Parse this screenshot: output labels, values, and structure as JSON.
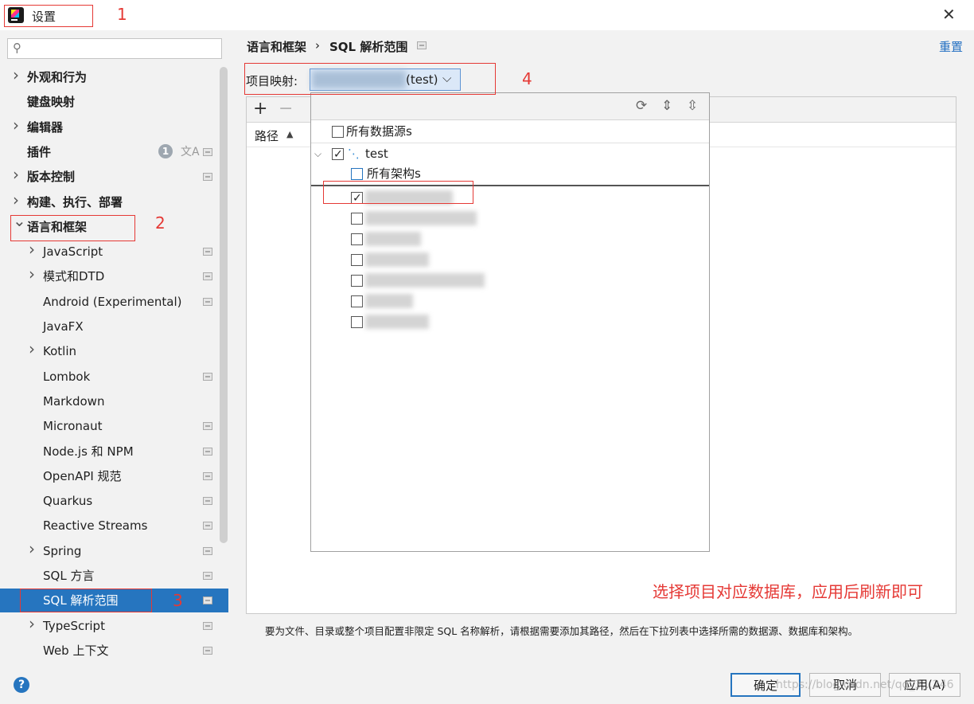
{
  "window": {
    "title": "设置",
    "close_glyph": "✕"
  },
  "sidebar": {
    "search_placeholder": "",
    "badge_count": "1",
    "items": [
      {
        "label": "外观和行为",
        "bold": true,
        "arrow": "right"
      },
      {
        "label": "键盘映射",
        "bold": true,
        "arrow": ""
      },
      {
        "label": "编辑器",
        "bold": true,
        "arrow": "right"
      },
      {
        "label": "插件",
        "bold": true,
        "arrow": ""
      },
      {
        "label": "版本控制",
        "bold": true,
        "arrow": "right"
      },
      {
        "label": "构建、执行、部署",
        "bold": true,
        "arrow": "right"
      },
      {
        "label": "语言和框架",
        "bold": true,
        "arrow": "down"
      },
      {
        "label": "JavaScript",
        "arrow": "right"
      },
      {
        "label": "模式和DTD",
        "arrow": "right"
      },
      {
        "label": "Android (Experimental)",
        "arrow": ""
      },
      {
        "label": "JavaFX",
        "arrow": ""
      },
      {
        "label": "Kotlin",
        "arrow": "right"
      },
      {
        "label": "Lombok",
        "arrow": ""
      },
      {
        "label": "Markdown",
        "arrow": ""
      },
      {
        "label": "Micronaut",
        "arrow": ""
      },
      {
        "label": "Node.js 和 NPM",
        "arrow": ""
      },
      {
        "label": "OpenAPI 规范",
        "arrow": ""
      },
      {
        "label": "Quarkus",
        "arrow": ""
      },
      {
        "label": "Reactive Streams",
        "arrow": ""
      },
      {
        "label": "Spring",
        "arrow": "right"
      },
      {
        "label": "SQL 方言",
        "arrow": ""
      },
      {
        "label": "SQL 解析范围",
        "arrow": "",
        "selected": true
      },
      {
        "label": "TypeScript",
        "arrow": "right"
      },
      {
        "label": "Web 上下文",
        "arrow": ""
      }
    ]
  },
  "breadcrumb": {
    "parent": "语言和框架",
    "separator": "›",
    "current": "SQL 解析范围"
  },
  "reset_label": "重置",
  "mapping": {
    "label": "项目映射:",
    "value": "(test)"
  },
  "table": {
    "column_path": "路径",
    "add_glyph": "+",
    "remove_glyph": "−"
  },
  "dropdown": {
    "all_datasources": "所有数据源s",
    "datasource_name": "test",
    "all_schemas": "所有架构s"
  },
  "annotations": {
    "n1": "1",
    "n2": "2",
    "n3": "3",
    "n4": "4",
    "note": "选择项目对应数据库，应用后刷新即可"
  },
  "description": "要为文件、目录或整个项目配置非限定 SQL 名称解析，请根据需要添加其路径，然后在下拉列表中选择所需的数据源、数据库和架构。",
  "footer": {
    "help": "?",
    "ok": "确定",
    "cancel": "取消",
    "apply": "应用(A)"
  },
  "watermark": "https://blog.csdn.net/qq_3...246",
  "colors": {
    "accent": "#2675bf",
    "annotation": "#e53935",
    "selection": "#2675bf"
  }
}
